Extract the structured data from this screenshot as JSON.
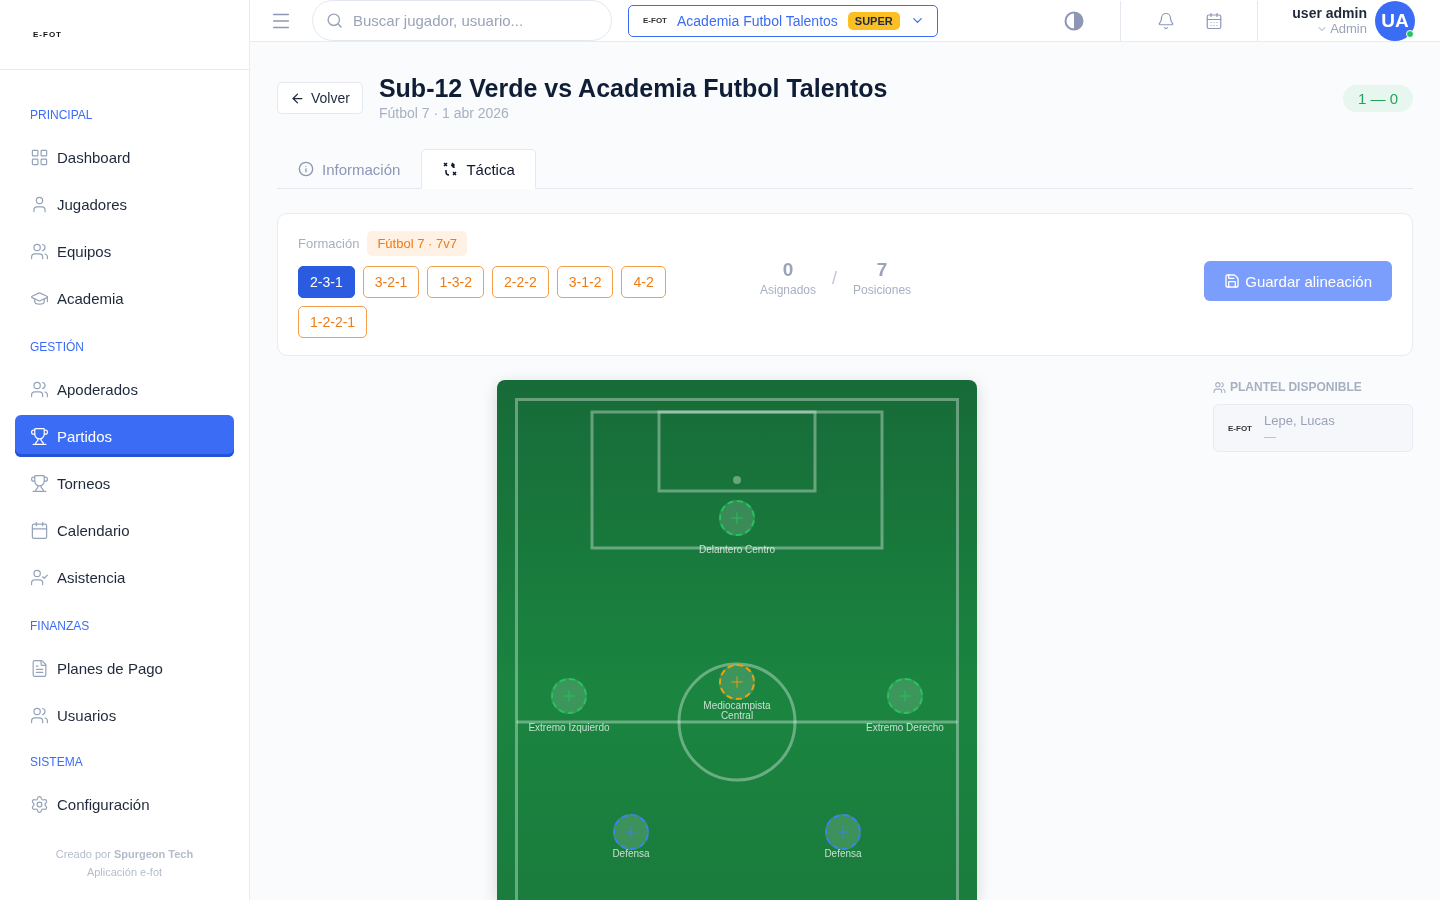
{
  "sidebar": {
    "logo": "E-FOT",
    "sections": [
      {
        "title": "PRINCIPAL",
        "items": [
          {
            "label": "Dashboard",
            "selected": false
          },
          {
            "label": "Jugadores",
            "selected": false
          },
          {
            "label": "Equipos",
            "selected": false
          },
          {
            "label": "Academia",
            "selected": false
          }
        ]
      },
      {
        "title": "GESTIÓN",
        "items": [
          {
            "label": "Apoderados",
            "selected": false
          },
          {
            "label": "Partidos",
            "selected": true
          },
          {
            "label": "Torneos",
            "selected": false
          },
          {
            "label": "Calendario",
            "selected": false
          },
          {
            "label": "Asistencia",
            "selected": false
          }
        ]
      },
      {
        "title": "FINANZAS",
        "items": [
          {
            "label": "Planes de Pago",
            "selected": false
          },
          {
            "label": "Usuarios",
            "selected": false
          }
        ]
      },
      {
        "title": "SISTEMA",
        "items": [
          {
            "label": "Configuración",
            "selected": false
          }
        ]
      }
    ],
    "footer": {
      "credit": "Creado por **Spurgeon Tech**",
      "app": "Aplicación e-fot"
    }
  },
  "header": {
    "search": {
      "placeholder": "Buscar jugador, usuario..."
    },
    "club": {
      "logo": "E-FOT",
      "name": "Academia Futbol Talentos",
      "badge": "SUPER"
    },
    "user": {
      "name": "user admin",
      "role": "Admin",
      "initials": "UA",
      "online": true
    }
  },
  "match": {
    "back": "Volver",
    "title": "Sub-12 Verde vs Academia Futbol Talentos",
    "subtitle": "Fútbol 7 · 1 abr 2026",
    "score": "1 — 0"
  },
  "tabs": [
    {
      "label": "Información",
      "selected": false
    },
    {
      "label": "Táctica",
      "selected": true
    }
  ],
  "formation": {
    "label": "Formación",
    "tag": "Fútbol 7 · 7v7",
    "options": [
      {
        "label": "2-3-1",
        "selected": true
      },
      {
        "label": "3-2-1",
        "selected": false
      },
      {
        "label": "1-3-2",
        "selected": false
      },
      {
        "label": "2-2-2",
        "selected": false
      },
      {
        "label": "3-1-2",
        "selected": false
      },
      {
        "label": "4-2",
        "selected": false
      },
      {
        "label": "1-2-2-1",
        "selected": false
      }
    ],
    "assigned": {
      "value": "0",
      "label": "Asignados"
    },
    "separator": "/",
    "positions": {
      "value": "7",
      "label": "Posiciones"
    },
    "save": {
      "label": "Guardar alineación",
      "disabled": true
    }
  },
  "pitch": {
    "slots": [
      {
        "name": "Delantero Centro",
        "color": "#22c55e"
      },
      {
        "name": "Extremo Izquierdo",
        "color": "#22c55e"
      },
      {
        "name": "Mediocampista Central",
        "color": "#f59e0b"
      },
      {
        "name": "Extremo Derecho",
        "color": "#22c55e"
      },
      {
        "name": "Defensa",
        "color": "#3b82f6"
      },
      {
        "name": "Defensa",
        "color": "#3b82f6"
      }
    ]
  },
  "squad": {
    "title": "PLANTEL DISPONIBLE",
    "players": [
      {
        "logo": "E-FOT",
        "name": "Lepe, Lucas",
        "detail": "—"
      }
    ]
  }
}
